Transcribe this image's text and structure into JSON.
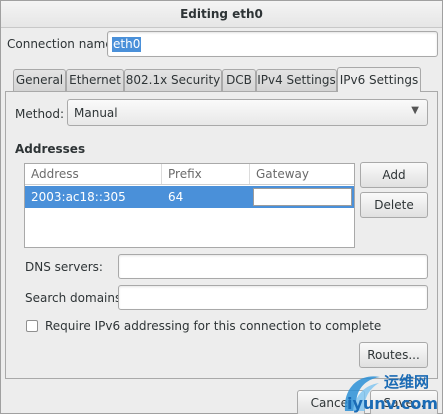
{
  "window": {
    "title": "Editing eth0"
  },
  "connection": {
    "label": "Connection name:",
    "value": "eth0"
  },
  "tabs": [
    {
      "label": "General"
    },
    {
      "label": "Ethernet"
    },
    {
      "label": "802.1x Security"
    },
    {
      "label": "DCB"
    },
    {
      "label": "IPv4 Settings"
    },
    {
      "label": "IPv6 Settings",
      "active": true
    }
  ],
  "method": {
    "label": "Method:",
    "value": "Manual"
  },
  "addresses": {
    "heading": "Addresses",
    "columns": [
      "Address",
      "Prefix",
      "Gateway"
    ],
    "rows": [
      {
        "address": "2003:ac18::305",
        "prefix": "64",
        "gateway": ""
      }
    ],
    "add_label": "Add",
    "delete_label": "Delete"
  },
  "dns": {
    "label": "DNS servers:",
    "value": ""
  },
  "search": {
    "label": "Search domains:",
    "value": ""
  },
  "require_ipv6": {
    "label": "Require IPv6 addressing for this connection to complete",
    "checked": false
  },
  "routes_label": "Routes...",
  "footer": {
    "cancel_label": "Cancel",
    "save_label": "Save..."
  },
  "watermark": {
    "line1": "运维网",
    "line2": "iyunv.com"
  },
  "colors": {
    "selection": "#4a90d9",
    "window_bg": "#ededed"
  }
}
